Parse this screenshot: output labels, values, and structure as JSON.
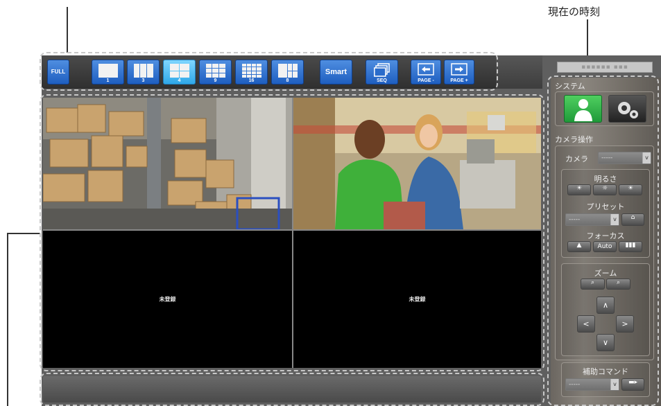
{
  "callout": {
    "current_time_label": "現在の時刻"
  },
  "toolbar": {
    "full_label": "FULL",
    "layout_buttons": [
      {
        "label": "1"
      },
      {
        "label": "3"
      },
      {
        "label": "4"
      },
      {
        "label": "9"
      },
      {
        "label": "16"
      },
      {
        "label": "8"
      }
    ],
    "active_layout": "4",
    "smart_label": "Smart",
    "seq_label": "SEQ",
    "page_prev_label": "PAGE -",
    "page_next_label": "PAGE +"
  },
  "video": {
    "tiles": [
      {
        "label": ""
      },
      {
        "label": ""
      },
      {
        "label": "未登録"
      },
      {
        "label": "未登録"
      }
    ]
  },
  "panel": {
    "system_title": "システム",
    "camera_ops_title": "カメラ操作",
    "camera_label": "カメラ",
    "camera_value": "-----",
    "brightness_label": "明るさ",
    "preset_label": "プリセット",
    "preset_value": "-----",
    "focus_label": "フォーカス",
    "focus_auto": "Auto",
    "zoom_label": "ズーム",
    "aux_cmd_label": "補助コマンド",
    "aux_cmd_value": "-----"
  },
  "colors": {
    "accent": "#1e5ec0",
    "active": "#2fa8e8",
    "system_user": "#2fa84f"
  }
}
